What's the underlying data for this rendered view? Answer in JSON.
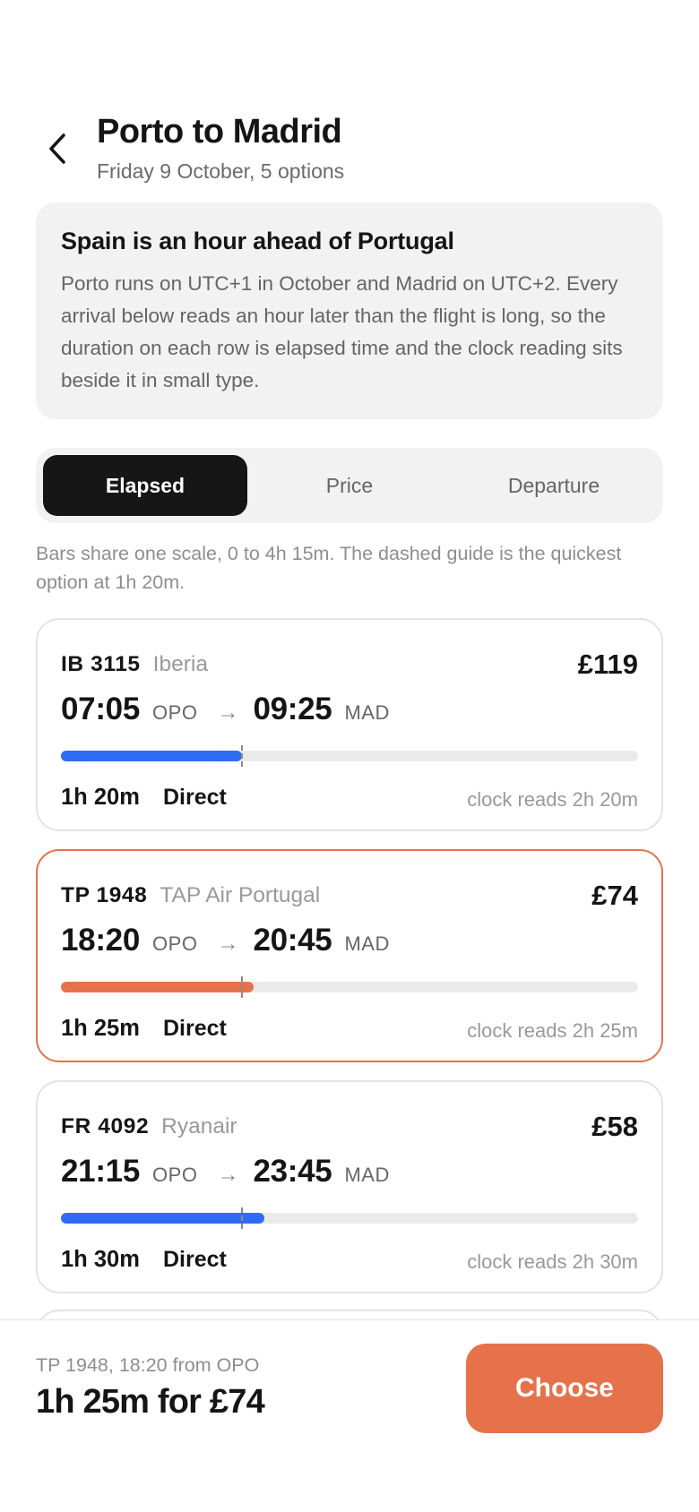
{
  "header": {
    "title": "Porto to Madrid",
    "subtitle": "Friday 9 October, 5 options",
    "back_icon": "chevron-left-icon"
  },
  "notice": {
    "title": "Spain is an hour ahead of Portugal",
    "body": "Porto runs on UTC+1 in October and Madrid on UTC+2. Every arrival below reads an hour later than the flight is long, so the duration on each row is elapsed time and the clock reading sits beside it in small type."
  },
  "sort": {
    "options": [
      "Elapsed",
      "Price",
      "Departure"
    ],
    "selected": "Elapsed"
  },
  "scale_note": "Bars share one scale, 0 to 4h 15m. The dashed guide is the quickest option at 1h 20m.",
  "scale": {
    "max_minutes": 255,
    "guide_minutes": 80
  },
  "colors": {
    "accent": "#e5724a",
    "bar": "#2f6cf5",
    "track": "#eaeaea"
  },
  "flights": [
    {
      "flight_no": "IB 3115",
      "airline": "Iberia",
      "price": "£119",
      "dep_time": "07:05",
      "dep_code": "OPO",
      "arr_time": "09:25",
      "arr_code": "MAD",
      "duration": "1h 20m",
      "duration_minutes": 80,
      "stops": "Direct",
      "clock": "clock reads 2h 20m",
      "selected": false
    },
    {
      "flight_no": "TP 1948",
      "airline": "TAP Air Portugal",
      "price": "£74",
      "dep_time": "18:20",
      "dep_code": "OPO",
      "arr_time": "20:45",
      "arr_code": "MAD",
      "duration": "1h 25m",
      "duration_minutes": 85,
      "stops": "Direct",
      "clock": "clock reads 2h 25m",
      "selected": true
    },
    {
      "flight_no": "FR 4092",
      "airline": "Ryanair",
      "price": "£58",
      "dep_time": "21:15",
      "dep_code": "OPO",
      "arr_time": "23:45",
      "arr_code": "MAD",
      "duration": "1h 30m",
      "duration_minutes": 90,
      "stops": "Direct",
      "clock": "clock reads 2h 30m",
      "selected": false
    }
  ],
  "footer": {
    "caption": "TP 1948, 18:20 from OPO",
    "summary": "1h 25m for £74",
    "button_label": "Choose"
  }
}
